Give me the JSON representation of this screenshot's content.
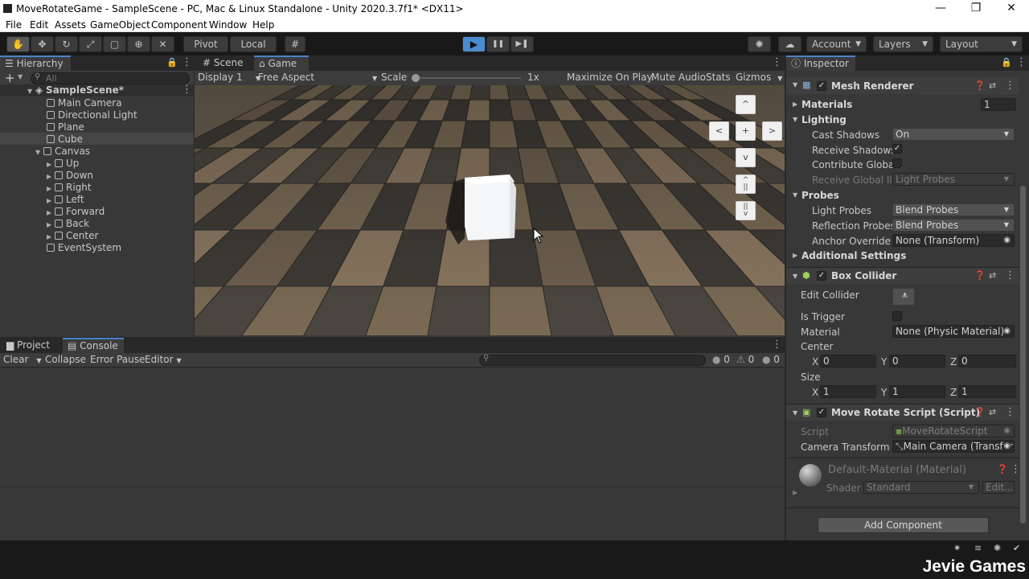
{
  "window": {
    "title": "MoveRotateGame - SampleScene - PC, Mac & Linux Standalone - Unity 2020.3.7f1* <DX11>",
    "minimize": "—",
    "restore": "❐",
    "close": "✕"
  },
  "menu": [
    "File",
    "Edit",
    "Assets",
    "GameObject",
    "Component",
    "Window",
    "Help"
  ],
  "toolbar": {
    "pivot": "Pivot",
    "local": "Local",
    "play": "▶",
    "pause": "❚❚",
    "step": "▶❚",
    "account": "Account",
    "layers": "Layers",
    "layout": "Layout"
  },
  "hierarchy": {
    "tab": "Hierarchy",
    "add": "+",
    "search_placeholder": "All",
    "scene": "SampleScene*",
    "items": [
      {
        "label": "Main Camera"
      },
      {
        "label": "Directional Light"
      },
      {
        "label": "Plane"
      },
      {
        "label": "Cube"
      },
      {
        "label": "Canvas"
      },
      {
        "label": "Up"
      },
      {
        "label": "Down"
      },
      {
        "label": "Right"
      },
      {
        "label": "Left"
      },
      {
        "label": "Forward"
      },
      {
        "label": "Back"
      },
      {
        "label": "Center"
      },
      {
        "label": "EventSystem"
      }
    ]
  },
  "game": {
    "tab_scene": "Scene",
    "tab_game": "Game",
    "display": "Display 1",
    "aspect": "Free Aspect",
    "scale_label": "Scale",
    "scale_value": "1x",
    "scale_fraction": 0,
    "maximize": "Maximize On Play",
    "mute": "Mute Audio",
    "stats": "Stats",
    "gizmos": "Gizmos",
    "buttons": {
      "up": "^",
      "left": "<",
      "center": "+",
      "right": ">",
      "down": "v",
      "forward": "^\n||",
      "back": "||\nv"
    }
  },
  "console": {
    "tab_project": "Project",
    "tab_console": "Console",
    "clear": "Clear",
    "collapse": "Collapse",
    "error_pause": "Error Pause",
    "editor": "Editor",
    "count_log": "0",
    "count_warn": "0",
    "count_err": "0"
  },
  "inspector": {
    "tab": "Inspector",
    "mesh_renderer": {
      "title": "Mesh Renderer",
      "materials": "Materials",
      "materials_count": "1",
      "lighting": "Lighting",
      "cast_shadows_label": "Cast Shadows",
      "cast_shadows_value": "On",
      "receive_shadows_label": "Receive Shadows",
      "contribute_gi_label": "Contribute Global I",
      "receive_gi_label": "Receive Global Illu",
      "receive_gi_value": "Light Probes",
      "probes": "Probes",
      "light_probes_label": "Light Probes",
      "light_probes_value": "Blend Probes",
      "reflection_probes_label": "Reflection Probes",
      "reflection_probes_value": "Blend Probes",
      "anchor_label": "Anchor Override",
      "anchor_value": "None (Transform)",
      "additional": "Additional Settings"
    },
    "box_collider": {
      "title": "Box Collider",
      "edit_collider": "Edit Collider",
      "is_trigger": "Is Trigger",
      "material_label": "Material",
      "material_value": "None (Physic Material)",
      "center": "Center",
      "center_x": "0",
      "center_y": "0",
      "center_z": "0",
      "size": "Size",
      "size_x": "1",
      "size_y": "1",
      "size_z": "1",
      "x": "X",
      "y": "Y",
      "z": "Z"
    },
    "script": {
      "title": "Move Rotate Script (Script)",
      "script_label": "Script",
      "script_value": "MoveRotateScript",
      "camera_label": "Camera Transform",
      "camera_value": "Main Camera (Transfor"
    },
    "material": {
      "title": "Default-Material (Material)",
      "shader_label": "Shader",
      "shader_value": "Standard",
      "edit": "Edit..."
    },
    "add_component": "Add Component"
  },
  "watermark": "Jevie Games",
  "colors": {
    "accent": "#4a8ccf",
    "panel": "#383838",
    "dark": "#191919"
  }
}
